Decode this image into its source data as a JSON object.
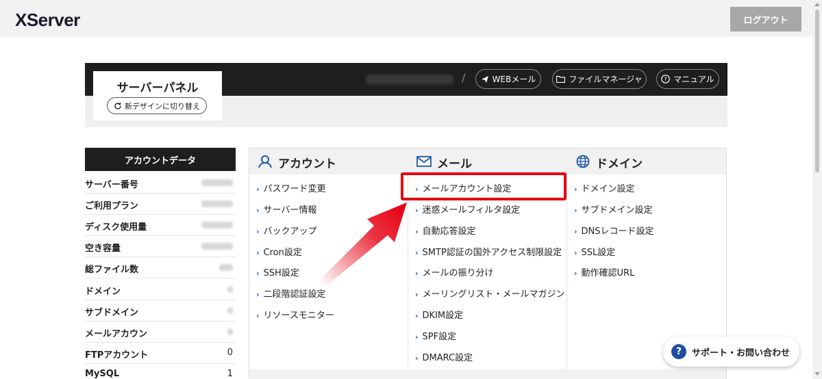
{
  "topbar": {
    "logo": "XServer",
    "logout_label": "ログアウト"
  },
  "panel": {
    "title": "サーバーパネル",
    "new_design_label": "新デザインに切り替え",
    "separator": "/",
    "links": [
      {
        "label": "WEBメール",
        "icon": "send-icon"
      },
      {
        "label": "ファイルマネージャ",
        "icon": "folder-icon"
      },
      {
        "label": "マニュアル",
        "icon": "help-icon"
      }
    ]
  },
  "account_data": {
    "heading": "アカウントデータ",
    "rows": [
      {
        "label": "サーバー番号",
        "value": ""
      },
      {
        "label": "ご利用プラン",
        "value": ""
      },
      {
        "label": "ディスク使用量",
        "value": ""
      },
      {
        "label": "空き容量",
        "value": ""
      },
      {
        "label": "総ファイル数",
        "value": ""
      },
      {
        "label": "ドメイン",
        "value": ""
      },
      {
        "label": "サブドメイン",
        "value": ""
      },
      {
        "label": "メールアカウン",
        "value": ""
      },
      {
        "label": "FTPアカウント",
        "value": "0"
      },
      {
        "label": "MySQL",
        "value": "1"
      }
    ]
  },
  "menu": {
    "account": {
      "title": "アカウント",
      "items": [
        "パスワード変更",
        "サーバー情報",
        "バックアップ",
        "Cron設定",
        "SSH設定",
        "二段階認証設定",
        "リソースモニター"
      ]
    },
    "mail": {
      "title": "メール",
      "items": [
        "メールアカウント設定",
        "迷惑メールフィルタ設定",
        "自動応答設定",
        "SMTP認証の国外アクセス制限設定",
        "メールの振り分け",
        "メーリングリスト・メールマガジン",
        "DKIM設定",
        "SPF設定",
        "DMARC設定"
      ]
    },
    "domain": {
      "title": "ドメイン",
      "items": [
        "ドメイン設定",
        "サブドメイン設定",
        "DNSレコード設定",
        "SSL設定",
        "動作確認URL"
      ]
    }
  },
  "support": {
    "label": "サポート・お問い合わせ",
    "icon_glyph": "?"
  },
  "colors": {
    "highlight": "#e60012",
    "link_chevron": "#1e5aa8",
    "dark": "#1e1e1e"
  }
}
